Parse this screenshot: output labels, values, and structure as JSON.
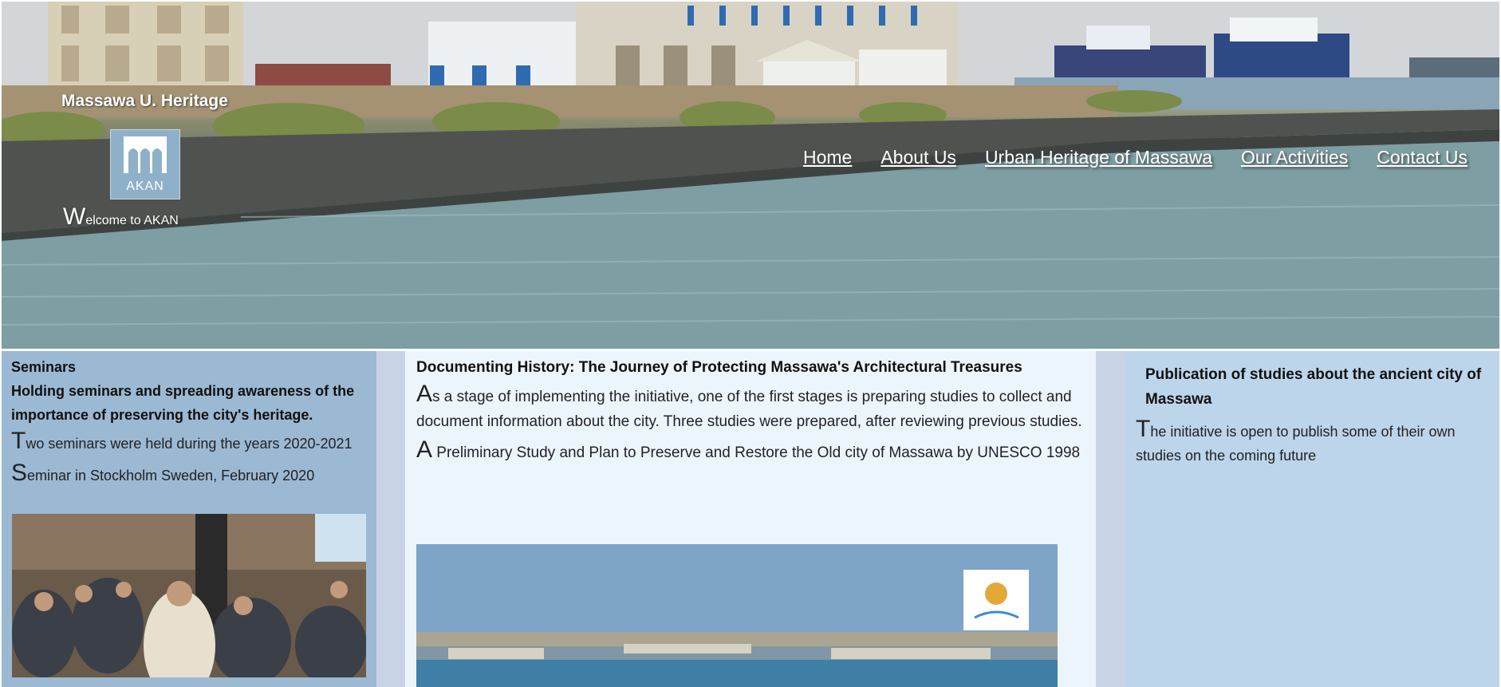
{
  "header": {
    "site_name": "Massawa U. Heritage",
    "logo_text": "AKAN",
    "welcome_first": "W",
    "welcome_rest": "elcome to AKAN"
  },
  "nav": {
    "items": [
      "Home",
      "About Us",
      "Urban Heritage of Massawa",
      "Our Activities",
      "Contact Us"
    ]
  },
  "left": {
    "title": "Seminars",
    "subtitle": "Holding seminars and spreading awareness of the importance of preserving the city's heritage.",
    "p1_first": "T",
    "p1_rest": "wo seminars were held during the years 2020-2021",
    "p2_first": "S",
    "p2_rest": "eminar in Stockholm Sweden, February 2020"
  },
  "middle": {
    "title": "Documenting History: The Journey of Protecting Massawa's Architectural Treasures",
    "p1_first": "A",
    "p1_rest": "s a stage of implementing the initiative, one of the first stages is preparing studies to collect and document information about the city. Three studies were prepared, after reviewing previous studies.",
    "p2_first": "A",
    "p2_rest": " Preliminary Study and Plan to Preserve and Restore the Old city of Massawa by UNESCO 1998"
  },
  "right": {
    "title": "Publication of studies about the ancient city of Massawa",
    "p1_first": "T",
    "p1_rest": "he initiative is open to publish some of their own studies on the coming future"
  },
  "colors": {
    "left_panel": "#9cb9d3",
    "middle_panel": "#edf5fc",
    "right_panel": "#bcd5ea",
    "gutter": "#c8d4e6",
    "nav_text": "#ffffff"
  }
}
